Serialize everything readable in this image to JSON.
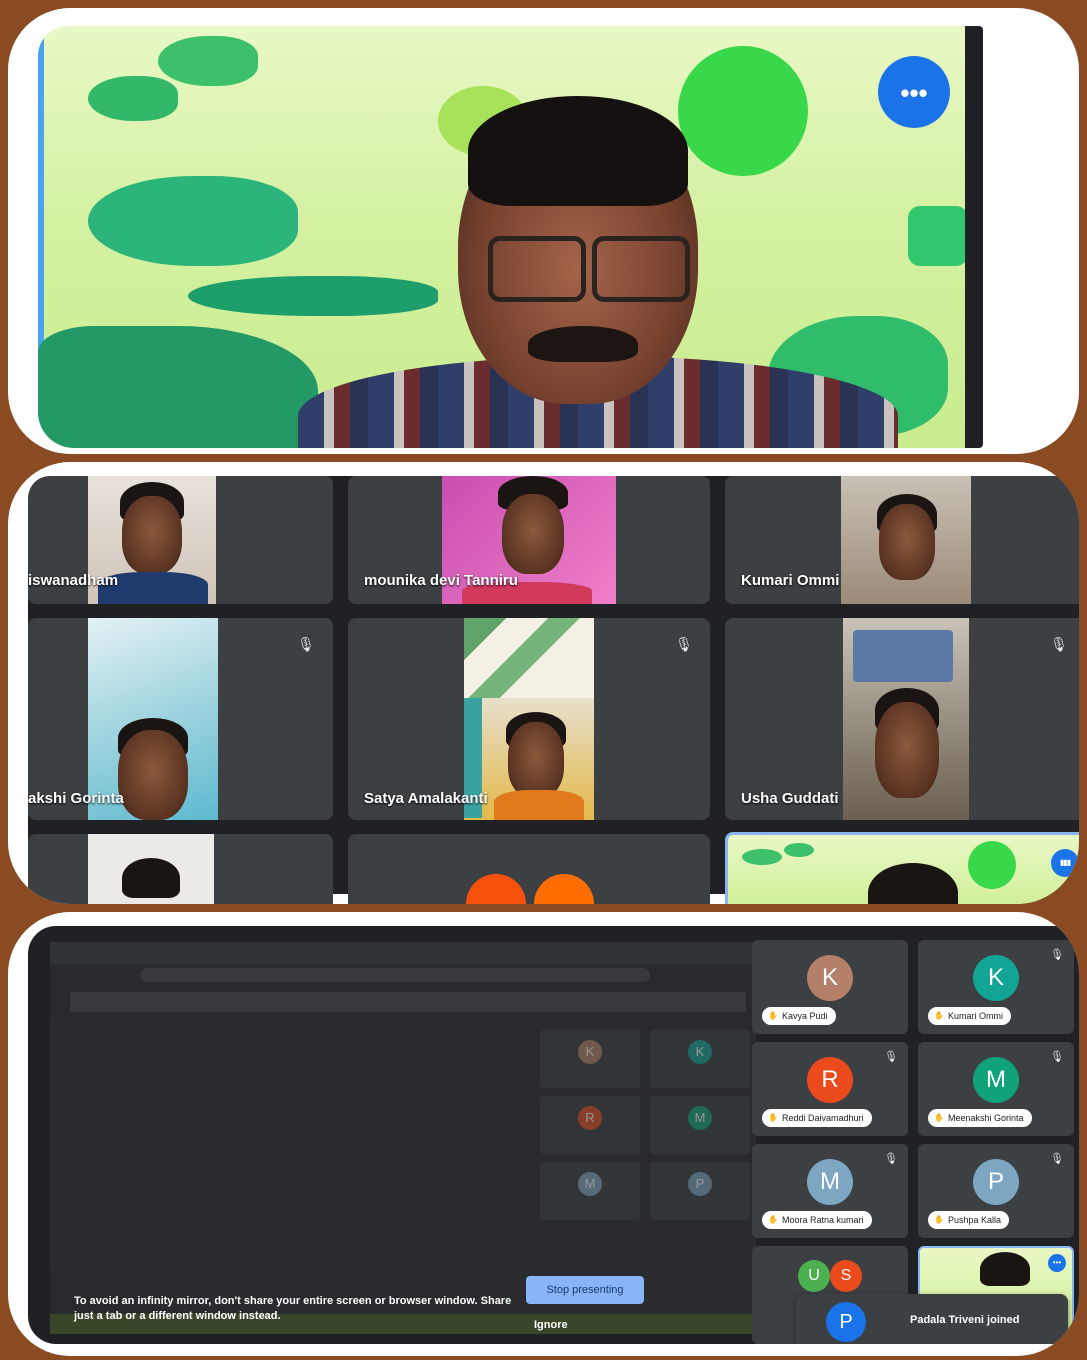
{
  "speaker": {
    "more_options_glyph": "•••",
    "icons": {
      "more": "more-options-icon"
    }
  },
  "gallery": {
    "tiles": [
      {
        "name": "iswanadham"
      },
      {
        "name": "mounika devi Tanniru"
      },
      {
        "name": "Kumari Ommi"
      },
      {
        "name": "akshi Gorinta"
      },
      {
        "name": "Satya Amalakanti"
      },
      {
        "name": "Usha Guddati"
      }
    ],
    "mic_off_glyph": "🎙",
    "speaking_glyph": "▮▮▮"
  },
  "share": {
    "participants": [
      {
        "initial": "K",
        "name": "Kavya Pudi",
        "color": "#b5806a",
        "muted": false
      },
      {
        "initial": "K",
        "name": "Kumari Ommi",
        "color": "#12a596",
        "muted": true
      },
      {
        "initial": "R",
        "name": "Reddi Daivamadhuri",
        "color": "#ea4a1c",
        "muted": true
      },
      {
        "initial": "M",
        "name": "Meenakshi Gorinta",
        "color": "#10a37a",
        "muted": true
      },
      {
        "initial": "M",
        "name": "Moora Ratna kumari",
        "color": "#7da6c2",
        "muted": true
      },
      {
        "initial": "P",
        "name": "Pushpa Kalla",
        "color": "#7da6c2",
        "muted": true
      }
    ],
    "partial_initials": [
      "U",
      "S"
    ],
    "warning_text": "To avoid an infinity mirror, don't share your entire screen or browser window. Share just a tab or a different window instead.",
    "stop_button": "Stop presenting",
    "ignore_button": "Ignore",
    "toast": {
      "initial": "P",
      "text": "Padala Triveni joined"
    }
  },
  "colors": {
    "accent": "#1a73e8",
    "tile": "#3c4043",
    "background": "#202124",
    "frame": "#8a4a22"
  }
}
